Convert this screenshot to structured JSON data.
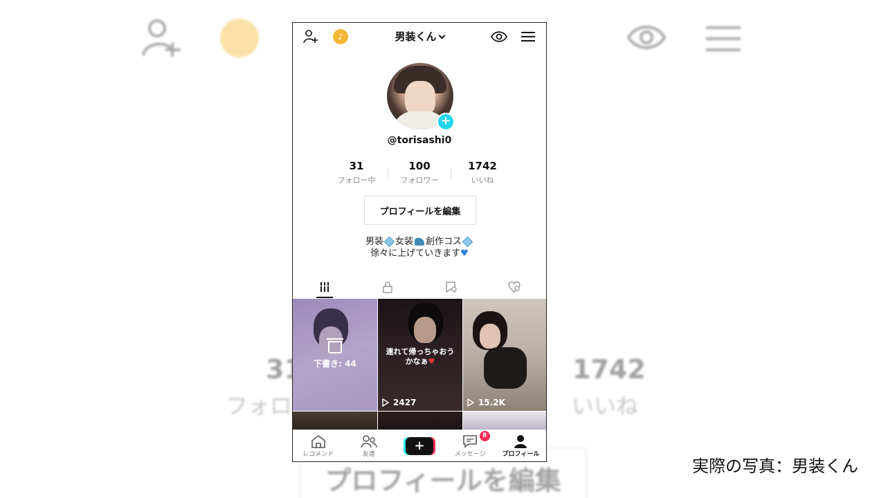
{
  "header": {
    "account_name": "男装くん"
  },
  "profile": {
    "username": "@torisashi0",
    "stats": [
      {
        "value": "31",
        "label": "フォロー中"
      },
      {
        "value": "100",
        "label": "フォロワー"
      },
      {
        "value": "1742",
        "label": "いいね"
      }
    ],
    "edit_button": "プロフィールを編集",
    "bio_line1_a": "男装",
    "bio_line1_b": "女装",
    "bio_line1_c": "創作コス",
    "bio_line2": "徐々に上げていきます"
  },
  "tabs": [
    {
      "icon": "grid-icon",
      "active": true
    },
    {
      "icon": "lock-icon",
      "active": false
    },
    {
      "icon": "saved-icon",
      "active": false
    },
    {
      "icon": "liked-icon",
      "active": false
    }
  ],
  "videos": [
    {
      "type": "draft",
      "label": "下書き: 44"
    },
    {
      "type": "video",
      "overlay_text_1": "連れて帰っちゃおう",
      "overlay_text_2": "かなぁ",
      "plays": "2427"
    },
    {
      "type": "video",
      "plays": "15.2K"
    }
  ],
  "bottom_nav": [
    {
      "label": "レコメンド",
      "icon": "home-icon"
    },
    {
      "label": "友達",
      "icon": "friends-icon"
    },
    {
      "label": "",
      "icon": "create-icon"
    },
    {
      "label": "メッセージ",
      "icon": "inbox-icon",
      "badge": "8"
    },
    {
      "label": "プロフィール",
      "icon": "profile-icon",
      "active": true
    }
  ],
  "background": {
    "stat_left": "31",
    "stat_left_label": "フォロ",
    "stat_right": "1742",
    "stat_right_label": "いいね",
    "edit_button": "プロフィールを編集"
  },
  "caption": "実際の写真：男装くん",
  "colors": {
    "accent_cyan": "#20d5ec",
    "accent_red": "#fe2c55",
    "coin": "#f5b731"
  }
}
